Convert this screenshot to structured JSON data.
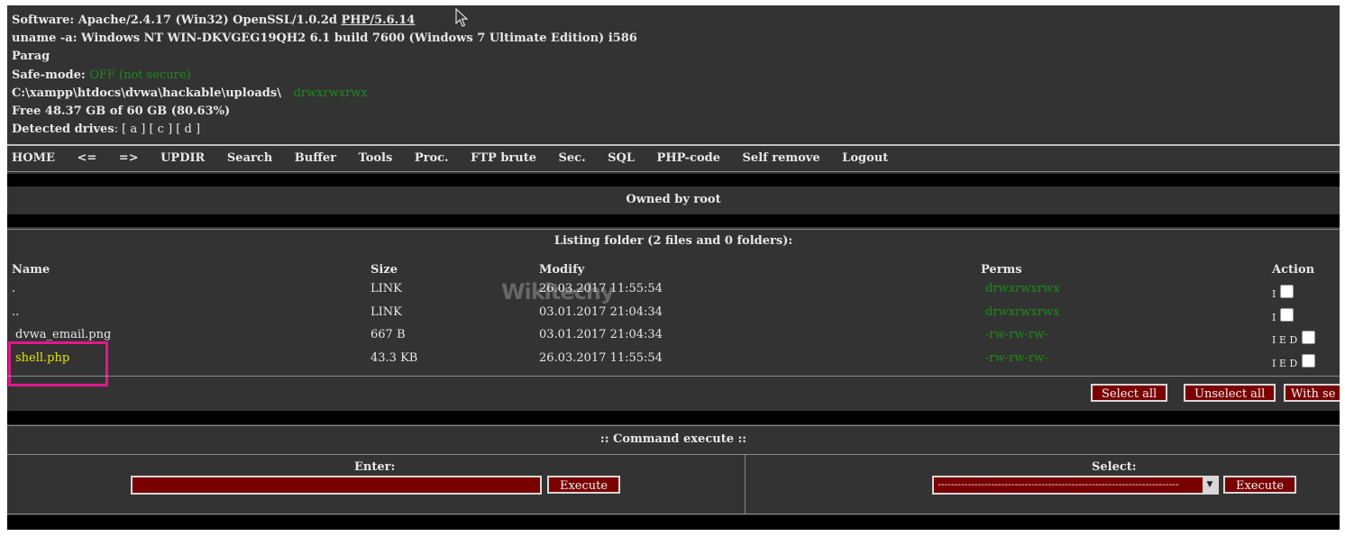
{
  "info": {
    "software_label": "Software:",
    "software_value": "Apache/2.4.17 (Win32) OpenSSL/1.0.2d",
    "php_link": "PHP/5.6.14",
    "uname_label": "uname -a:",
    "uname_value": "Windows NT WIN-DKVGEG19QH2 6.1 build 7600 (Windows 7 Ultimate Edition) i586",
    "user": "Parag",
    "safemode_label": "Safe-mode:",
    "safemode_value": "OFF (not secure)",
    "path": "C:\\xampp\\htdocs\\dvwa\\hackable\\uploads\\",
    "path_perms": "drwxrwxrwx",
    "free": "Free 48.37 GB of 60 GB (80.63%)",
    "drives_label": "Detected drives",
    "drives_value": ": [ a ] [ c ] [ d ]"
  },
  "menu": [
    "HOME",
    "<=",
    "=>",
    "UPDIR",
    "Search",
    "Buffer",
    "Tools",
    "Proc.",
    "FTP brute",
    "Sec.",
    "SQL",
    "PHP-code",
    "Self remove",
    "Logout"
  ],
  "owner": "Owned by root",
  "listing": {
    "title": "Listing folder (2 files and 0 folders):",
    "headers": {
      "name": "Name",
      "size": "Size",
      "modify": "Modify",
      "perms": "Perms",
      "action": "Action"
    },
    "rows": [
      {
        "name": ".",
        "size": "LINK",
        "modify": "26.03.2017 11:55:54",
        "perms": "drwxrwxrwx",
        "action": "I"
      },
      {
        "name": "..",
        "size": "LINK",
        "modify": "03.01.2017 21:04:34",
        "perms": "drwxrwxrwx",
        "action": "I"
      },
      {
        "name": "dvwa_email.png",
        "size": "667 B",
        "modify": "03.01.2017 21:04:34",
        "perms": "-rw-rw-rw-",
        "action": "I E D"
      },
      {
        "name": "shell.php",
        "size": "43.3 KB",
        "modify": "26.03.2017 11:55:54",
        "perms": "-rw-rw-rw-",
        "action": "I E D"
      }
    ],
    "buttons": {
      "select_all": "Select all",
      "unselect_all": "Unselect all",
      "with_selected": "With se"
    }
  },
  "command": {
    "title": ":: Command execute ::",
    "enter_label": "Enter:",
    "select_label": "Select:",
    "execute_label": "Execute",
    "select_value": "------------------------------------------------------------------------"
  },
  "colors": {
    "background": "#333333",
    "perm_green": "#1a8c1a",
    "highlight_yellow": "#e6e600",
    "button_red": "#7a0000",
    "annotation_pink": "#e0198a"
  },
  "watermark": "Wikitechy"
}
